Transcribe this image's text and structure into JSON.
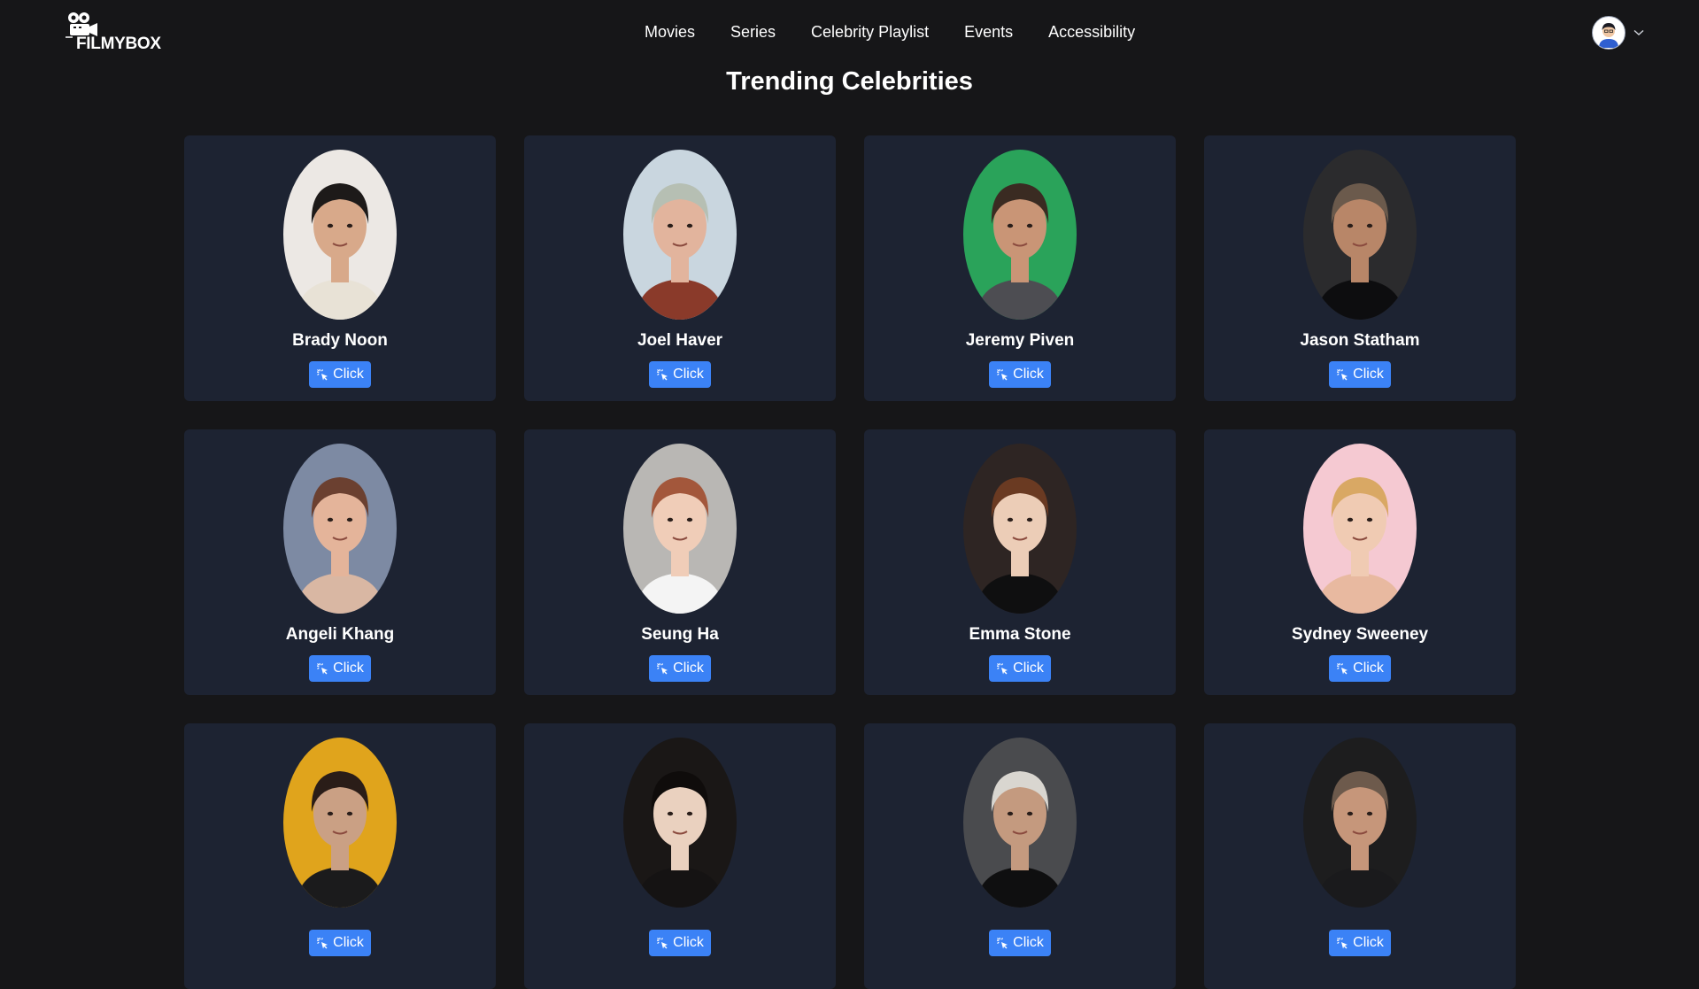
{
  "brand": {
    "name": "FILMYBOX",
    "icon": "film-camera-icon"
  },
  "nav": {
    "items": [
      {
        "label": "Movies"
      },
      {
        "label": "Series"
      },
      {
        "label": "Celebrity Playlist"
      },
      {
        "label": "Events"
      },
      {
        "label": "Accessibility"
      }
    ]
  },
  "profile": {
    "icon": "user-avatar",
    "menu_icon": "chevron-down-icon"
  },
  "page": {
    "title": "Trending Celebrities"
  },
  "celebrities": [
    {
      "name": "Brady Noon",
      "button_label": "Click",
      "bg": "#ece8e4",
      "hair": "#1d1a19",
      "skin": "#d8a98a",
      "shirt": "#e8e2d6"
    },
    {
      "name": "Joel Haver",
      "button_label": "Click",
      "bg": "#c9d6df",
      "hair": "#b6bfb3",
      "skin": "#e2b49d",
      "shirt": "#8a3a2a"
    },
    {
      "name": "Jeremy Piven",
      "button_label": "Click",
      "bg": "#2aa35a",
      "hair": "#3a2b22",
      "skin": "#c99576",
      "shirt": "#4d4d52"
    },
    {
      "name": "Jason Statham",
      "button_label": "Click",
      "bg": "#2b2b2d",
      "hair": "#6b5a4c",
      "skin": "#b88668",
      "shirt": "#0d0d0f"
    },
    {
      "name": "Angeli Khang",
      "button_label": "Click",
      "bg": "#7d8aa3",
      "hair": "#6b4030",
      "skin": "#e4b49a",
      "shirt": "#d9b7a3"
    },
    {
      "name": "Seung Ha",
      "button_label": "Click",
      "bg": "#b9b7b4",
      "hair": "#a3573b",
      "skin": "#f0cdb8",
      "shirt": "#f4f4f4"
    },
    {
      "name": "Emma Stone",
      "button_label": "Click",
      "bg": "#2e2523",
      "hair": "#6a3a22",
      "skin": "#eccdb7",
      "shirt": "#0f0f10"
    },
    {
      "name": "Sydney Sweeney",
      "button_label": "Click",
      "bg": "#f5c9d2",
      "hair": "#d9a864",
      "skin": "#f0cbb3",
      "shirt": "#e8b9a0"
    },
    {
      "name": "",
      "button_label": "Click",
      "bg": "#e0a41c",
      "hair": "#2a1d18",
      "skin": "#caa084",
      "shirt": "#1b1b1c"
    },
    {
      "name": "",
      "button_label": "Click",
      "bg": "#1a1716",
      "hair": "#0f0c0b",
      "skin": "#ead1bf",
      "shirt": "#151313"
    },
    {
      "name": "",
      "button_label": "Click",
      "bg": "#4a4b4e",
      "hair": "#d9d6d0",
      "skin": "#c49a7f",
      "shirt": "#0f0f10"
    },
    {
      "name": "",
      "button_label": "Click",
      "bg": "#1d1d1e",
      "hair": "#6d5a4c",
      "skin": "#c6967a",
      "shirt": "#1a1a1c"
    }
  ],
  "colors": {
    "accent": "#3b82f6",
    "card_bg": "#1d2332",
    "page_bg": "#161618"
  }
}
